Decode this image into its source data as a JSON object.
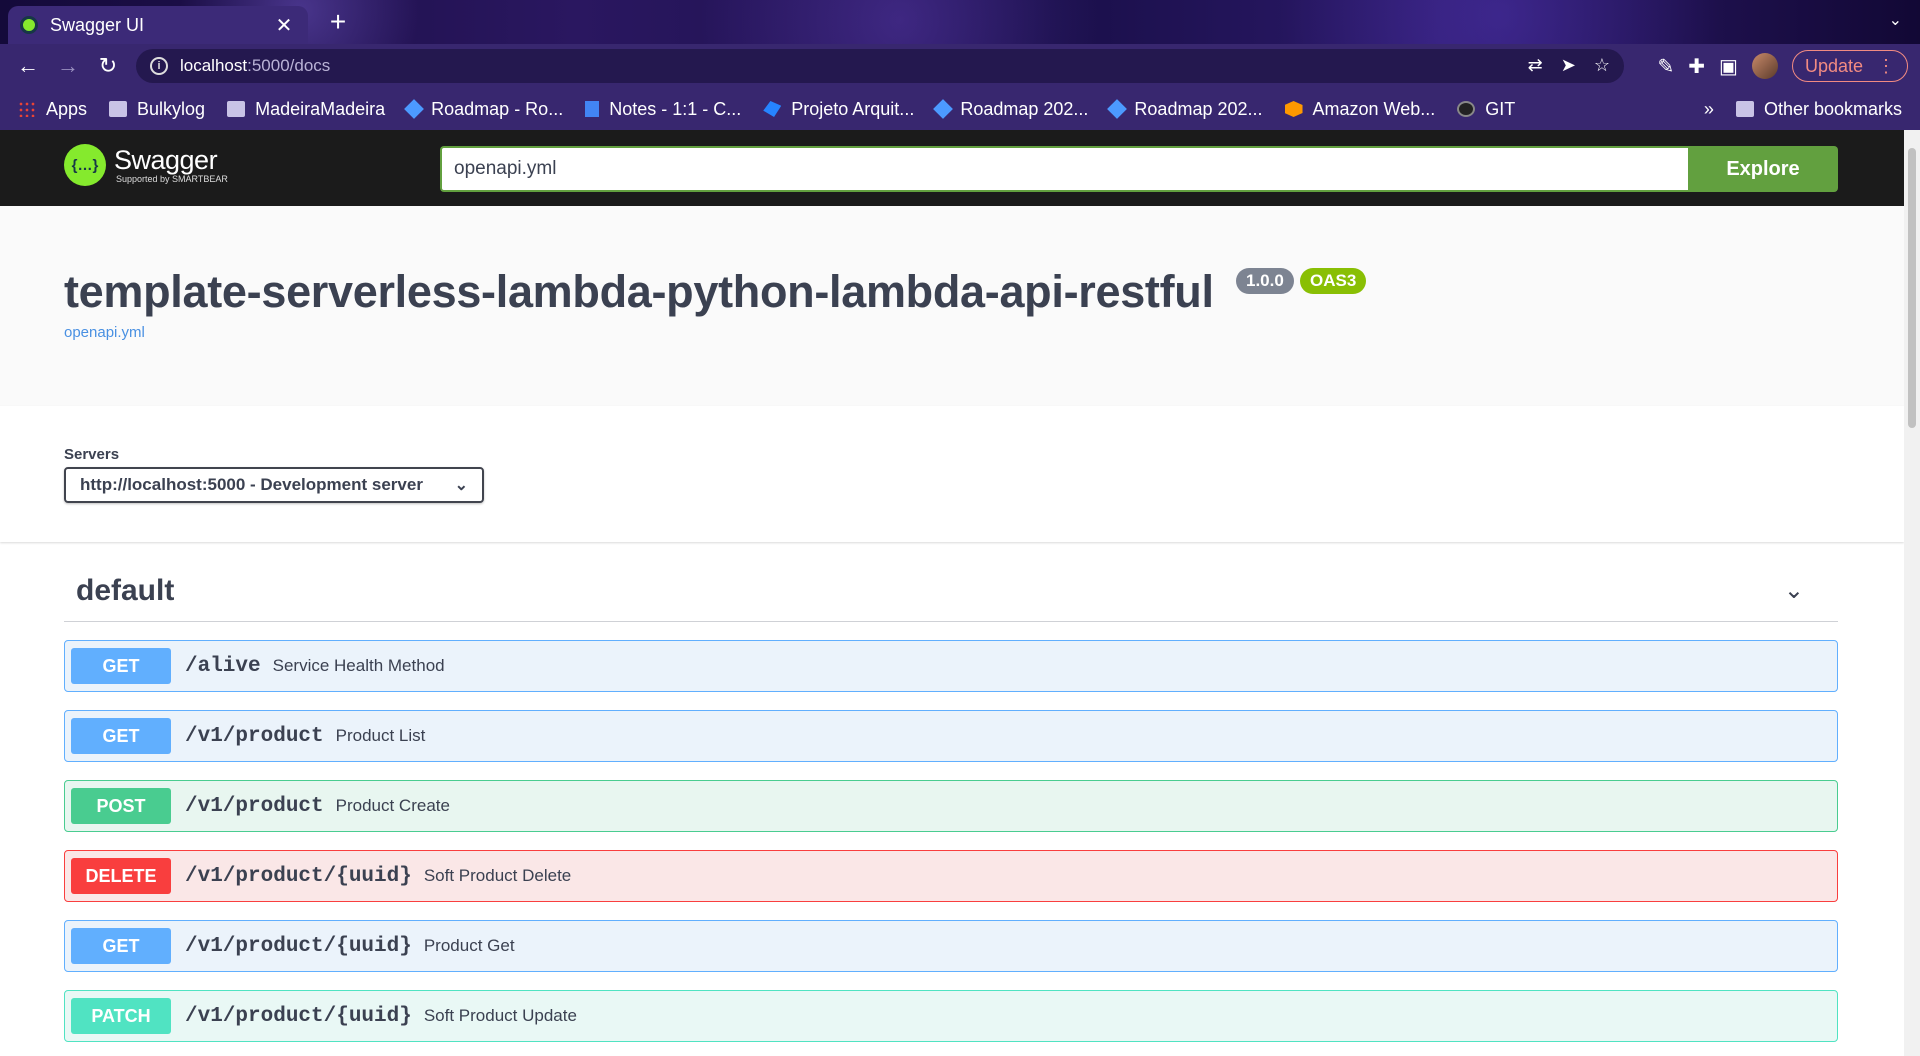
{
  "browser": {
    "tab_title": "Swagger UI",
    "url_host": "localhost",
    "url_path": ":5000/docs",
    "update_label": "Update",
    "bookmarks": [
      {
        "label": "Apps",
        "icon": "apps-grid-icon"
      },
      {
        "label": "Bulkylog",
        "icon": "folder-icon"
      },
      {
        "label": "MadeiraMadeira",
        "icon": "folder-icon"
      },
      {
        "label": "Roadmap - Ro...",
        "icon": "jira-icon"
      },
      {
        "label": "Notes - 1:1 - C...",
        "icon": "docs-icon"
      },
      {
        "label": "Projeto Arquit...",
        "icon": "confluence-icon"
      },
      {
        "label": "Roadmap 202...",
        "icon": "jira-icon"
      },
      {
        "label": "Roadmap 202...",
        "icon": "jira-icon"
      },
      {
        "label": "Amazon Web...",
        "icon": "aws-icon"
      },
      {
        "label": "GIT",
        "icon": "github-icon"
      }
    ],
    "bookmarks_more": "»",
    "other_bookmarks": "Other bookmarks"
  },
  "swagger": {
    "brand_name": "Swagger",
    "brand_sub": "Supported by SMARTBEAR",
    "spec_url_value": "openapi.yml",
    "explore_label": "Explore"
  },
  "info": {
    "title": "template-serverless-lambda-python-lambda-api-restful",
    "version": "1.0.0",
    "oas": "OAS3",
    "spec_link": "openapi.yml"
  },
  "servers": {
    "label": "Servers",
    "selected": "http://localhost:5000 - Development server"
  },
  "tag": {
    "name": "default",
    "operations": [
      {
        "method": "GET",
        "path": "/alive",
        "summary": "Service Health Method"
      },
      {
        "method": "GET",
        "path": "/v1/product",
        "summary": "Product List"
      },
      {
        "method": "POST",
        "path": "/v1/product",
        "summary": "Product Create"
      },
      {
        "method": "DELETE",
        "path": "/v1/product/{uuid}",
        "summary": "Soft Product Delete"
      },
      {
        "method": "GET",
        "path": "/v1/product/{uuid}",
        "summary": "Product Get"
      },
      {
        "method": "PATCH",
        "path": "/v1/product/{uuid}",
        "summary": "Soft Product Update"
      }
    ]
  },
  "colors": {
    "get": "#61affe",
    "post": "#49cc90",
    "delete": "#f93e3e",
    "patch": "#50e3c2",
    "put": "#fca130",
    "explore": "#62a03f"
  }
}
